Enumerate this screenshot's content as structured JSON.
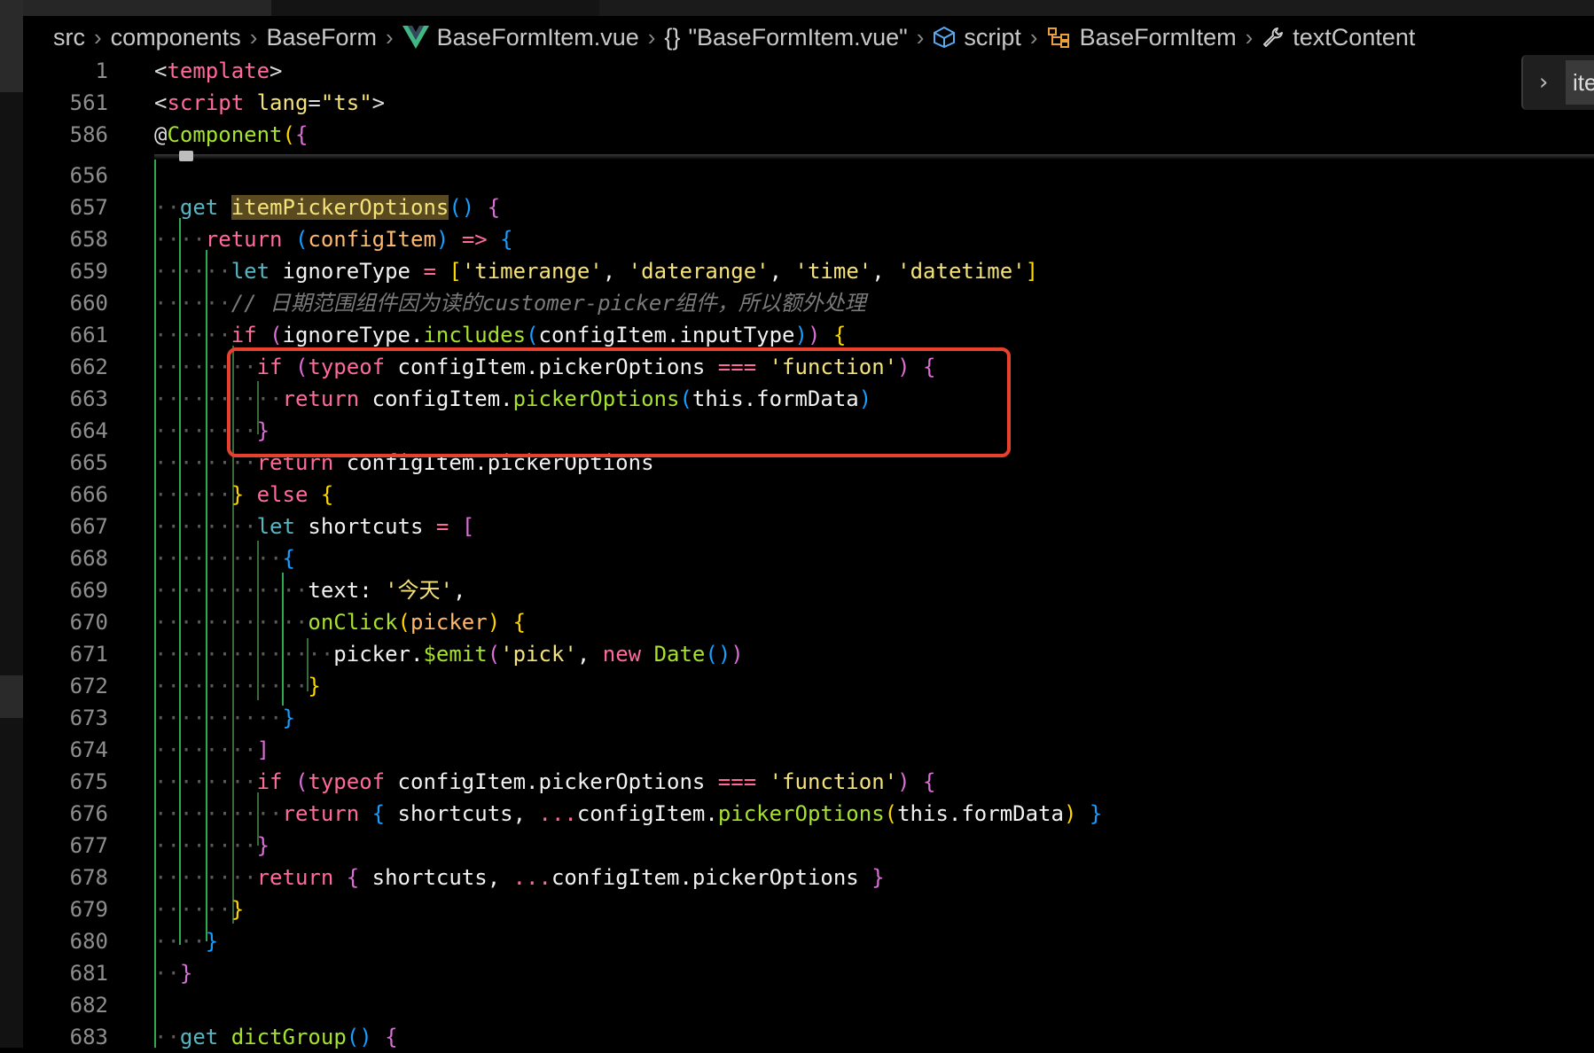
{
  "breadcrumb": [
    {
      "label": "src",
      "icon": ""
    },
    {
      "label": "components",
      "icon": ""
    },
    {
      "label": "BaseForm",
      "icon": ""
    },
    {
      "label": "BaseFormItem.vue",
      "icon": "vue-icon"
    },
    {
      "label": "\"BaseFormItem.vue\"",
      "icon": "braces-icon"
    },
    {
      "label": "script",
      "icon": "cube-icon"
    },
    {
      "label": "BaseFormItem",
      "icon": "class-icon"
    },
    {
      "label": "textContent",
      "icon": "wrench-icon"
    }
  ],
  "right_panel": {
    "tab_label": "ite"
  },
  "sticky_lines": [
    {
      "num": "1",
      "text": "<template>"
    },
    {
      "num": "561",
      "text": "<script lang=\"ts\">"
    },
    {
      "num": "586",
      "text": "@Component({"
    }
  ],
  "lines": [
    {
      "num": "656",
      "text": ""
    },
    {
      "num": "657",
      "text": "··get itemPickerOptions() {"
    },
    {
      "num": "658",
      "text": "····return (configItem) => {"
    },
    {
      "num": "659",
      "text": "······let ignoreType = ['timerange', 'daterange', 'time', 'datetime']"
    },
    {
      "num": "660",
      "text": "······// 日期范围组件因为读的customer-picker组件，所以额外处理"
    },
    {
      "num": "661",
      "text": "······if (ignoreType.includes(configItem.inputType)) {"
    },
    {
      "num": "662",
      "text": "········if (typeof configItem.pickerOptions === 'function') {"
    },
    {
      "num": "663",
      "text": "··········return configItem.pickerOptions(this.formData)"
    },
    {
      "num": "664",
      "text": "········}"
    },
    {
      "num": "665",
      "text": "········return configItem.pickerOptions"
    },
    {
      "num": "666",
      "text": "······} else {"
    },
    {
      "num": "667",
      "text": "········let shortcuts = ["
    },
    {
      "num": "668",
      "text": "··········{"
    },
    {
      "num": "669",
      "text": "············text: '今天',"
    },
    {
      "num": "670",
      "text": "············onClick(picker) {"
    },
    {
      "num": "671",
      "text": "··············picker.$emit('pick', new Date())"
    },
    {
      "num": "672",
      "text": "············}"
    },
    {
      "num": "673",
      "text": "··········}"
    },
    {
      "num": "674",
      "text": "········]"
    },
    {
      "num": "675",
      "text": "········if (typeof configItem.pickerOptions === 'function') {"
    },
    {
      "num": "676",
      "text": "··········return { shortcuts, ...configItem.pickerOptions(this.formData) }"
    },
    {
      "num": "677",
      "text": "········}"
    },
    {
      "num": "678",
      "text": "········return { shortcuts, ...configItem.pickerOptions }"
    },
    {
      "num": "679",
      "text": "······}"
    },
    {
      "num": "680",
      "text": "····}"
    },
    {
      "num": "681",
      "text": "··}"
    },
    {
      "num": "682",
      "text": ""
    },
    {
      "num": "683",
      "text": "··get dictGroup() {"
    }
  ]
}
